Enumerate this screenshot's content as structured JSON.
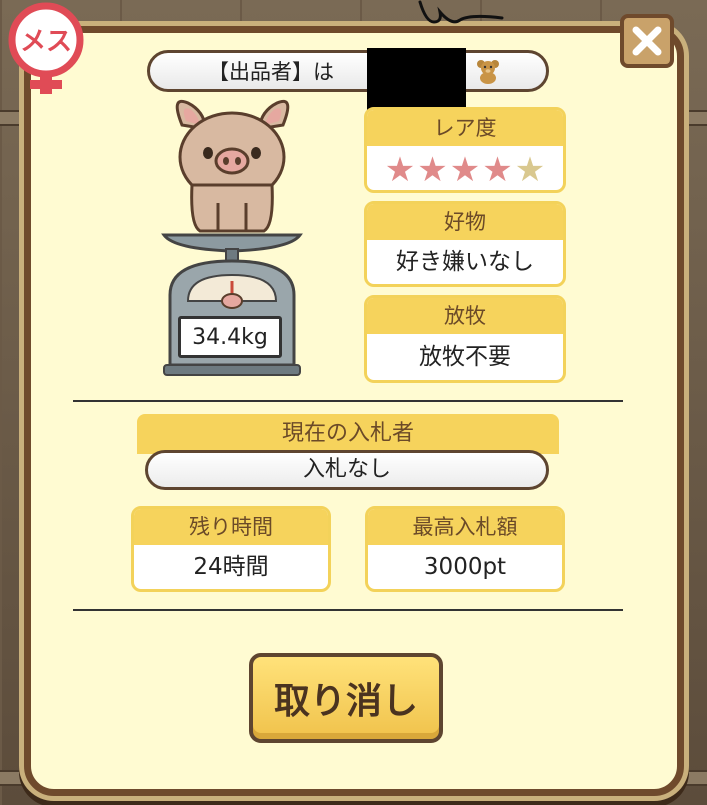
{
  "gender_badge": {
    "text": "メス",
    "icon": "female-symbol-icon"
  },
  "close": {
    "label": "×"
  },
  "seller": {
    "text": "【出品者】は",
    "icon": "teddy-bear-icon"
  },
  "pig": {
    "weight": "34.4kg"
  },
  "rarity": {
    "label": "レア度",
    "stars_filled": 4,
    "stars_total": 5
  },
  "favorite": {
    "label": "好物",
    "value": "好き嫌いなし"
  },
  "grazing": {
    "label": "放牧",
    "value": "放牧不要"
  },
  "current_bidder": {
    "label": "現在の入札者",
    "value": "入札なし"
  },
  "time_left": {
    "label": "残り時間",
    "value": "24時間"
  },
  "max_bid": {
    "label": "最高入札額",
    "value": "3000pt"
  },
  "cancel": {
    "label": "取り消し"
  },
  "colors": {
    "accent": "#f6d35c",
    "panel": "#fffbd2",
    "border": "#6f4a2c",
    "star_on": "#e08a8a",
    "star_off": "#d9c88f"
  }
}
